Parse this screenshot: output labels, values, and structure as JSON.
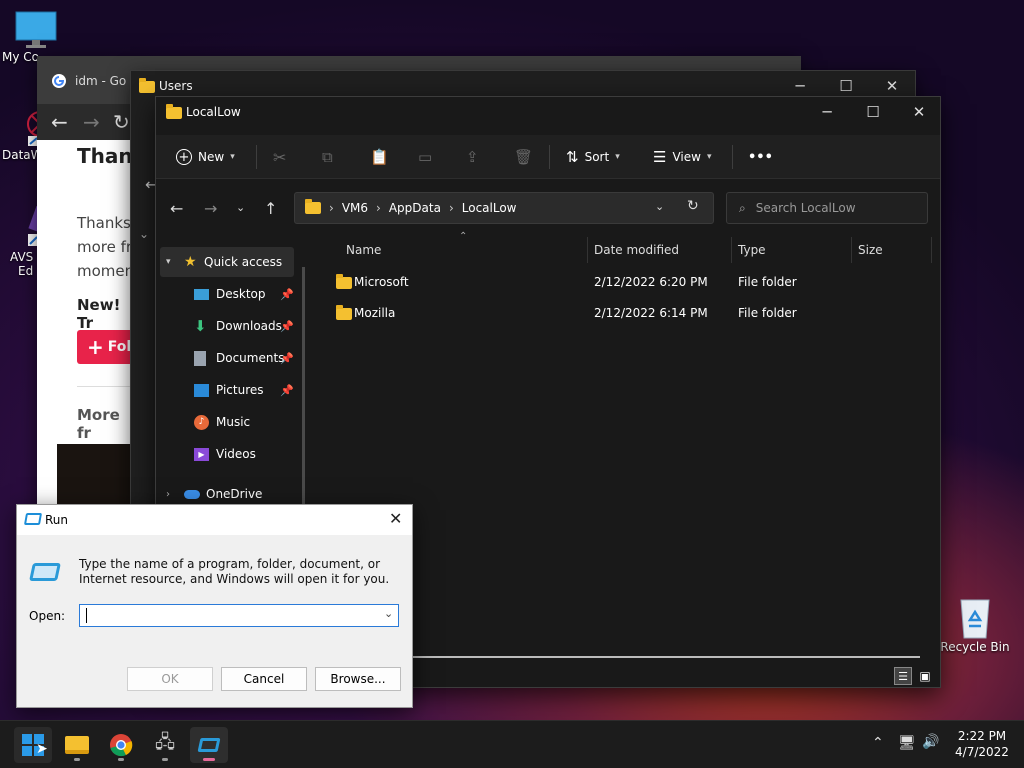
{
  "desktop": {
    "icons": [
      {
        "label": "My Co"
      },
      {
        "label": "DataW"
      },
      {
        "label": "AVS V"
      },
      {
        "label": "Ed"
      },
      {
        "label": "Recycle Bin"
      }
    ]
  },
  "browser": {
    "tab_title": "idm - Go",
    "content": {
      "heading": "Thank",
      "para_line1": "Thanks",
      "para_line2": "more fr",
      "para_line3": "momen",
      "new_label": "New! Tr",
      "follow_label": "Foll",
      "more_from": "More fr"
    }
  },
  "users_window": {
    "title": "Users"
  },
  "explorer": {
    "title": "LocalLow",
    "toolbar": {
      "new_label": "New",
      "sort_label": "Sort",
      "view_label": "View",
      "more_label": "•••"
    },
    "breadcrumb": [
      "VM6",
      "AppData",
      "LocalLow"
    ],
    "search_placeholder": "Search LocalLow",
    "columns": {
      "name": "Name",
      "date": "Date modified",
      "type": "Type",
      "size": "Size"
    },
    "nav": {
      "quick_access": "Quick access",
      "items": [
        {
          "label": "Desktop",
          "icon": "desktop-icon",
          "pinned": true
        },
        {
          "label": "Downloads",
          "icon": "downloads-icon",
          "pinned": true
        },
        {
          "label": "Documents",
          "icon": "documents-icon",
          "pinned": true
        },
        {
          "label": "Pictures",
          "icon": "pictures-icon",
          "pinned": true
        },
        {
          "label": "Music",
          "icon": "music-icon",
          "pinned": false
        },
        {
          "label": "Videos",
          "icon": "videos-icon",
          "pinned": false
        }
      ],
      "onedrive": "OneDrive"
    },
    "files": [
      {
        "name": "Microsoft",
        "date": "2/12/2022 6:20 PM",
        "type": "File folder",
        "size": ""
      },
      {
        "name": "Mozilla",
        "date": "2/12/2022 6:14 PM",
        "type": "File folder",
        "size": ""
      }
    ]
  },
  "run_dialog": {
    "title": "Run",
    "description": "Type the name of a program, folder, document, or Internet resource, and Windows will open it for you.",
    "open_label": "Open:",
    "open_value": "",
    "ok": "OK",
    "cancel": "Cancel",
    "browse": "Browse..."
  },
  "taskbar": {
    "time": "2:22 PM",
    "date": "4/7/2022"
  },
  "colors": {
    "accent": "#60cdff",
    "folder": "#f4c030",
    "follow_button": "#e8234a"
  }
}
